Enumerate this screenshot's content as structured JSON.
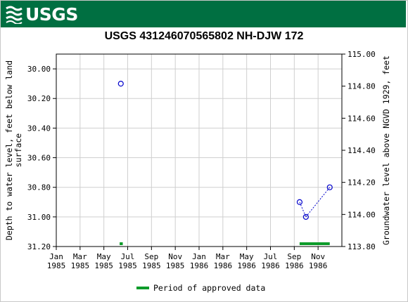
{
  "header": {
    "logo_text": "USGS",
    "brand_color": "#006f41"
  },
  "chart_data": {
    "type": "scatter",
    "title": "USGS 431246070565802 NH-DJW  172",
    "ylabel_left": "Depth to water level, feet below land surface",
    "ylabel_right": "Groundwater level above NGVD 1929, feet",
    "y_left_range": [
      31.2,
      29.9
    ],
    "y_left_ticks": [
      "30.00",
      "30.20",
      "30.40",
      "30.60",
      "30.80",
      "31.00",
      "31.20"
    ],
    "y_right_range": [
      113.8,
      115.0
    ],
    "y_right_ticks": [
      "115.00",
      "114.80",
      "114.60",
      "114.40",
      "114.20",
      "114.00",
      "113.80"
    ],
    "x_ticks": [
      {
        "month": "Jan",
        "year": "1985"
      },
      {
        "month": "Mar",
        "year": "1985"
      },
      {
        "month": "May",
        "year": "1985"
      },
      {
        "month": "Jul",
        "year": "1985"
      },
      {
        "month": "Sep",
        "year": "1985"
      },
      {
        "month": "Nov",
        "year": "1985"
      },
      {
        "month": "Jan",
        "year": "1986"
      },
      {
        "month": "Mar",
        "year": "1986"
      },
      {
        "month": "May",
        "year": "1986"
      },
      {
        "month": "Jul",
        "year": "1986"
      },
      {
        "month": "Sep",
        "year": "1986"
      },
      {
        "month": "Nov",
        "year": "1986"
      }
    ],
    "x_range": [
      "1985-01-01",
      "1987-01-01"
    ],
    "points": [
      {
        "date": "1985-06-15",
        "depth": 30.1
      },
      {
        "date": "1986-09-15",
        "depth": 30.9
      },
      {
        "date": "1986-10-01",
        "depth": 31.0
      },
      {
        "date": "1986-12-01",
        "depth": 30.8
      }
    ],
    "connected_segments": [
      [
        1,
        2
      ],
      [
        2,
        3
      ]
    ],
    "approved_periods": [
      {
        "start": "1985-06-12",
        "end": "1985-06-20"
      },
      {
        "start": "1986-09-15",
        "end": "1986-12-01"
      }
    ],
    "point_color": "#0000cc",
    "approved_color": "#0d9b2a",
    "grid": true,
    "legend": {
      "label": "Period of approved data",
      "placement": "bottom-center"
    }
  }
}
